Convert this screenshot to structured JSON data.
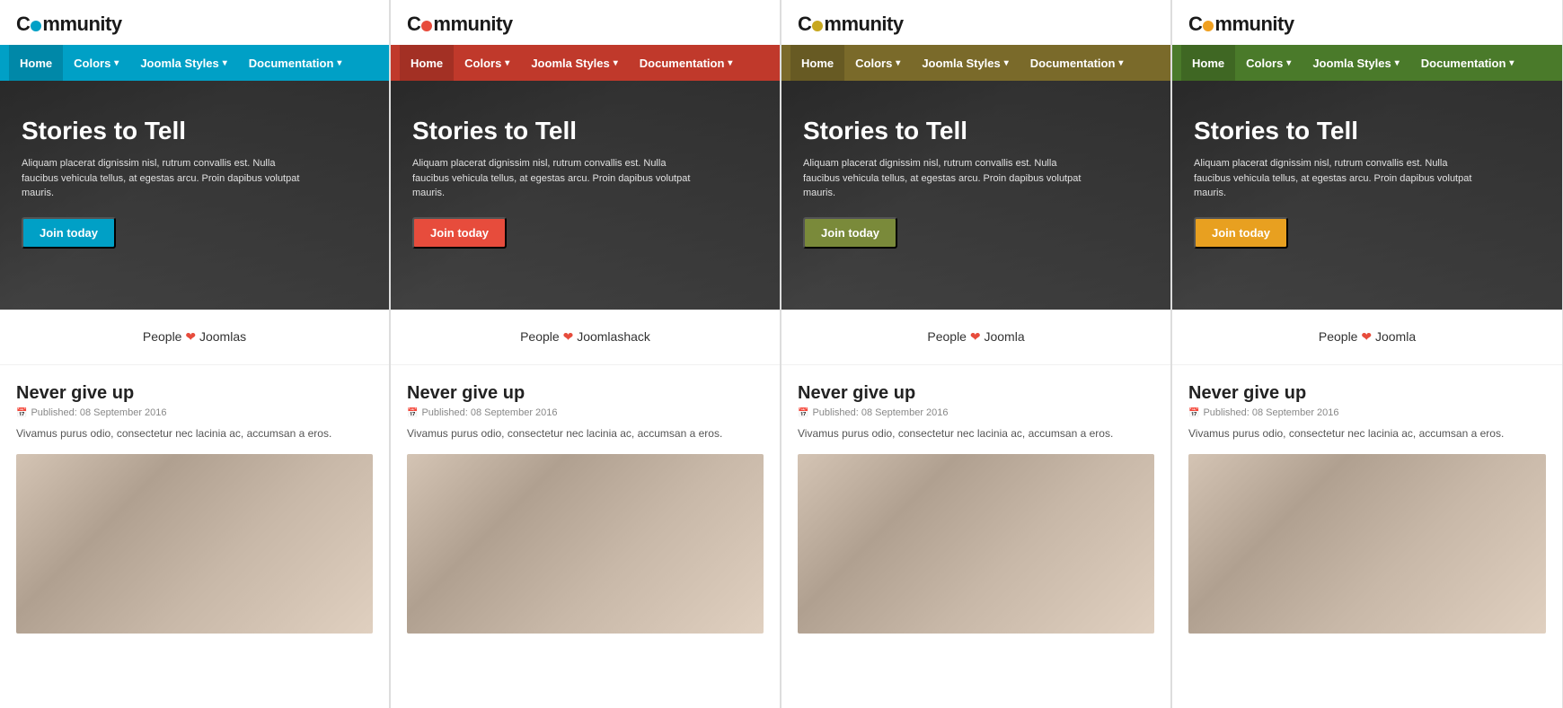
{
  "columns": [
    {
      "id": "col-1",
      "colorClass": "col-1",
      "logoText1": "C",
      "logoText2": "mmunity",
      "dotColor": "#00a0c6",
      "navColor": "#00a0c6",
      "btnColor": "#00a0c6",
      "nav": {
        "items": [
          {
            "label": "Home",
            "active": true
          },
          {
            "label": "Colors",
            "dropdown": true
          },
          {
            "label": "Joomla Styles",
            "dropdown": true
          },
          {
            "label": "Documentation",
            "dropdown": true
          }
        ]
      },
      "hero": {
        "title": "Stories to Tell",
        "text": "Aliquam placerat dignissim nisl, rutrum convallis est. Nulla faucibus vehicula tellus, at egestas arcu. Proin dapibus volutpat mauris.",
        "btnLabel": "Join today"
      },
      "peopleLine": "People ❤ Joomlas",
      "article": {
        "title": "Never give up",
        "metaIcon": "📅",
        "metaText": "Published: 08 September 2016",
        "excerpt": "Vivamus purus odio, consectetur nec lacinia ac, accumsan a eros."
      }
    },
    {
      "id": "col-2",
      "colorClass": "col-2",
      "logoText1": "C",
      "logoText2": "mmunity",
      "dotColor": "#e74c3c",
      "navColor": "#c0392b",
      "btnColor": "#e74c3c",
      "nav": {
        "items": [
          {
            "label": "Home",
            "active": true
          },
          {
            "label": "Colors",
            "dropdown": true
          },
          {
            "label": "Joomla Styles",
            "dropdown": true
          },
          {
            "label": "Documentation",
            "dropdown": true
          }
        ]
      },
      "hero": {
        "title": "Stories to Tell",
        "text": "Aliquam placerat dignissim nisl, rutrum convallis est. Nulla faucibus vehicula tellus, at egestas arcu. Proin dapibus volutpat mauris.",
        "btnLabel": "Join today"
      },
      "peopleLine": "People ❤ Joomlashack",
      "article": {
        "title": "Never give up",
        "metaIcon": "📅",
        "metaText": "Published: 08 September 2016",
        "excerpt": "Vivamus purus odio, consectetur nec lacinia ac, accumsan a eros."
      }
    },
    {
      "id": "col-3",
      "colorClass": "col-3",
      "logoText1": "C",
      "logoText2": "mmunity",
      "dotColor": "#c8a820",
      "navColor": "#7a6a2a",
      "btnColor": "#7a8a3a",
      "nav": {
        "items": [
          {
            "label": "Home",
            "active": true
          },
          {
            "label": "Colors",
            "dropdown": true
          },
          {
            "label": "Joomla Styles",
            "dropdown": true
          },
          {
            "label": "Documentation",
            "dropdown": true
          }
        ]
      },
      "hero": {
        "title": "Stories to Tell",
        "text": "Aliquam placerat dignissim nisl, rutrum convallis est. Nulla faucibus vehicula tellus, at egestas arcu. Proin dapibus volutpat mauris.",
        "btnLabel": "Join today"
      },
      "peopleLine": "People ❤ Joomla",
      "article": {
        "title": "Never give up",
        "metaIcon": "📅",
        "metaText": "Published: 08 September 2016",
        "excerpt": "Vivamus purus odio, consectetur nec lacinia ac, accumsan a eros."
      }
    },
    {
      "id": "col-4",
      "colorClass": "col-4",
      "logoText1": "C",
      "logoText2": "mmunity",
      "dotColor": "#f0a020",
      "navColor": "#4a7a2a",
      "btnColor": "#e8a020",
      "nav": {
        "items": [
          {
            "label": "Home",
            "active": true
          },
          {
            "label": "Colors",
            "dropdown": true
          },
          {
            "label": "Joomla Styles",
            "dropdown": true
          },
          {
            "label": "Documentation",
            "dropdown": true
          }
        ]
      },
      "hero": {
        "title": "Stories to Tell",
        "text": "Aliquam placerat dignissim nisl, rutrum convallis est. Nulla faucibus vehicula tellus, at egestas arcu. Proin dapibus volutpat mauris.",
        "btnLabel": "Join today"
      },
      "peopleLine": "People ❤ Joomla",
      "article": {
        "title": "Never give up",
        "metaIcon": "📅",
        "metaText": "Published: 08 September 2016",
        "excerpt": "Vivamus purus odio, consectetur nec lacinia ac, accumsan a eros."
      }
    }
  ]
}
